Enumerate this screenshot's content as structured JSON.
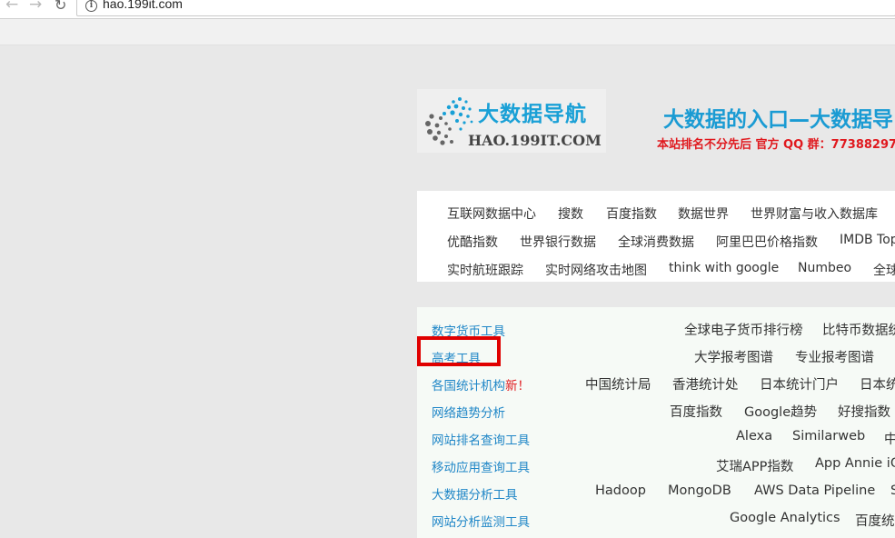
{
  "browser": {
    "url": "hao.199it.com",
    "back_icon": "←",
    "forward_icon": "→",
    "reload_icon": "↻",
    "info_icon": "i"
  },
  "header": {
    "logo_title": "大数据导航",
    "logo_domain": "HAO.199IT.COM",
    "slogan": "大数据的入口—大数据导",
    "note": "本站排名不分先后  官方 QQ 群：77388297"
  },
  "quick_links": {
    "rows": [
      [
        "互联网数据中心",
        "搜数",
        "百度指数",
        "数据世界",
        "世界财富与收入数据库"
      ],
      [
        "优酷指数",
        "世界银行数据",
        "全球消费数据",
        "阿里巴巴价格指数",
        "IMDB Top"
      ],
      [
        "实时航班跟踪",
        "实时网络攻击地图",
        "think with google",
        "Numbeo",
        "全球"
      ]
    ]
  },
  "tools": {
    "rows": [
      {
        "category": "数字货币工具",
        "badge": "",
        "links": [
          "全球电子货币排行榜",
          "比特币数据统"
        ]
      },
      {
        "category": "高考工具",
        "badge": "",
        "links": [
          "大学报考图谱",
          "专业报考图谱"
        ]
      },
      {
        "category": "各国统计机构",
        "badge": "新！",
        "links": [
          "中国统计局",
          "香港统计处",
          "日本统计门户",
          "日本统"
        ]
      },
      {
        "category": "网络趋势分析",
        "badge": "",
        "links": [
          "百度指数",
          "Google趋势",
          "好搜指数"
        ]
      },
      {
        "category": "网站排名查询工具",
        "badge": "",
        "links": [
          "Alexa",
          "Similarweb",
          "中"
        ]
      },
      {
        "category": "移动应用查询工具",
        "badge": "",
        "links": [
          "艾瑞APP指数",
          "App Annie iO"
        ]
      },
      {
        "category": "大数据分析工具",
        "badge": "",
        "links": [
          "Hadoop",
          "MongoDB",
          "AWS Data Pipeline",
          "S"
        ]
      },
      {
        "category": "网站分析监测工具",
        "badge": "",
        "links": [
          "Google Analytics",
          "百度统"
        ]
      }
    ]
  },
  "colors": {
    "accent_blue": "#1a9bd3",
    "category_blue": "#1f86c7",
    "alert_red": "#e0191e",
    "highlight_red": "#e00000"
  }
}
